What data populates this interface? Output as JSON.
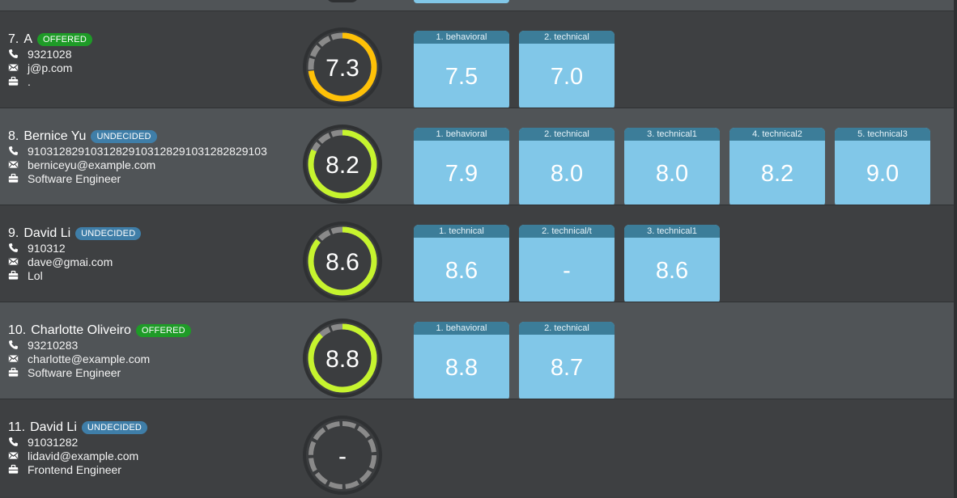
{
  "candidates": [
    {
      "index": "7.",
      "name": "A",
      "status": "OFFERED",
      "phone": "9321028",
      "email": "j@p.com",
      "job": ".",
      "overall_score": "7.3",
      "overall_fraction": 0.73,
      "ring_color": "#ffc107",
      "interviews": [
        {
          "label": "1. behavioral",
          "score": "7.5"
        },
        {
          "label": "2. technical",
          "score": "7.0"
        }
      ]
    },
    {
      "index": "8.",
      "name": "Bernice Yu",
      "status": "UNDECIDED",
      "phone": "91031282910312829103128291031282829103",
      "email": "berniceyu@example.com",
      "job": "Software Engineer",
      "overall_score": "8.2",
      "overall_fraction": 0.82,
      "ring_color": "#c6f42e",
      "interviews": [
        {
          "label": "1. behavioral",
          "score": "7.9"
        },
        {
          "label": "2. technical",
          "score": "8.0"
        },
        {
          "label": "3. technical1",
          "score": "8.0"
        },
        {
          "label": "4. technical2",
          "score": "8.2"
        },
        {
          "label": "5. technical3",
          "score": "9.0"
        }
      ]
    },
    {
      "index": "9.",
      "name": "David Li",
      "status": "UNDECIDED",
      "phone": "910312",
      "email": "dave@gmai.com",
      "job": "Lol",
      "overall_score": "8.6",
      "overall_fraction": 0.86,
      "ring_color": "#c6f42e",
      "interviews": [
        {
          "label": "1. technical",
          "score": "8.6"
        },
        {
          "label": "2. technical/t",
          "score": "-"
        },
        {
          "label": "3. technical1",
          "score": "8.6"
        }
      ]
    },
    {
      "index": "10.",
      "name": "Charlotte Oliveiro",
      "status": "OFFERED",
      "phone": "93210283",
      "email": "charlotte@example.com",
      "job": "Software Engineer",
      "overall_score": "8.8",
      "overall_fraction": 0.88,
      "ring_color": "#c6f42e",
      "interviews": [
        {
          "label": "1. behavioral",
          "score": "8.8"
        },
        {
          "label": "2. technical",
          "score": "8.7"
        }
      ]
    },
    {
      "index": "11.",
      "name": "David Li",
      "status": "UNDECIDED",
      "phone": "91031282",
      "email": "lidavid@example.com",
      "job": "Frontend Engineer",
      "overall_score": "-",
      "overall_fraction": 0,
      "ring_color": "#8a8a8a",
      "interviews": []
    }
  ],
  "colors": {
    "row_dark": "#3e4042",
    "row_light": "#505457",
    "offered_badge": "#1e9b27",
    "undecided_badge": "#3f7ea8",
    "card_bg": "#81c7e8",
    "card_header": "#3c7d99",
    "gauge_track": "#8a8a8a",
    "gauge_center": "#3b3d3f"
  },
  "icons": {
    "phone": "phone-icon",
    "email": "envelope-icon",
    "job": "briefcase-icon"
  }
}
